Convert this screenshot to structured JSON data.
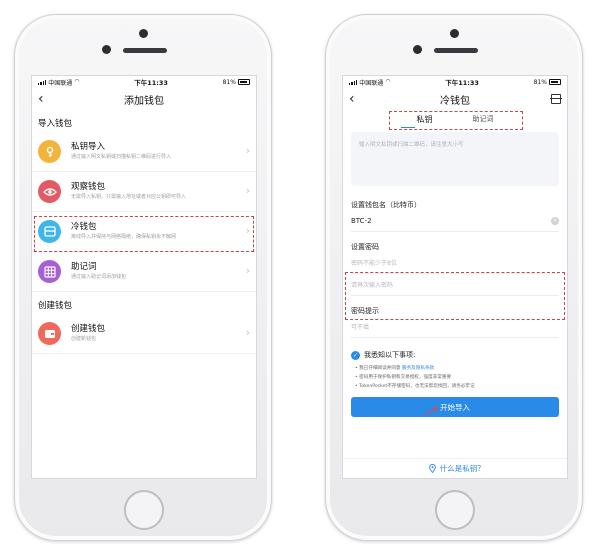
{
  "status_bar": {
    "carrier": "中国联通",
    "time": "下午11:33",
    "battery": "81%"
  },
  "left_screen": {
    "title": "添加钱包",
    "import_section": "导入钱包",
    "create_section": "创建钱包",
    "import_items": [
      {
        "title": "私钥导入",
        "desc": "通过输入明文私钥或扫描私钥二维码进行导入",
        "icon": "key-icon",
        "color": "#f2b43a"
      },
      {
        "title": "观察钱包",
        "desc": "无需导入私钥，只需输入地址或者对应公钥即可导入",
        "icon": "eye-icon",
        "color": "#e25a63"
      },
      {
        "title": "冷钱包",
        "desc": "离线导入并保持与网络隔绝，确保私钥永不触网",
        "icon": "cold-wallet-icon",
        "color": "#3fb6e8"
      },
      {
        "title": "助记词",
        "desc": "通过输入助记词添加钱包",
        "icon": "grid-icon",
        "color": "#a65fd6"
      }
    ],
    "create_items": [
      {
        "title": "创建钱包",
        "desc": "创建新钱包",
        "icon": "wallet-icon",
        "color": "#ef6a5a"
      }
    ]
  },
  "right_screen": {
    "title": "冷钱包",
    "tabs": [
      "私钥",
      "助记词"
    ],
    "key_placeholder": "输入明文私钥或扫描二维码，请注意大小写",
    "wallet_name_label": "设置钱包名（比特币）",
    "wallet_name_value": "BTC-2",
    "password_label": "设置密码",
    "password_placeholder": "密码不能少于8位",
    "password_confirm_placeholder": "请再次输入密码",
    "hint_label": "密码提示",
    "hint_placeholder": "可不填",
    "agree_title": "我悉知以下事项:",
    "notes": [
      {
        "text": "• 我已仔细阅读并同意 ",
        "link": "服务及隐私条款"
      },
      {
        "text": "• 密码用于保护私钥和交易授权，强度非常重要",
        "link": ""
      },
      {
        "text": "• TokenPocket不存储密码，也无法帮您找回，请务必牢记",
        "link": ""
      }
    ],
    "submit_label": "开始导入",
    "help_label": "什么是私钥?"
  },
  "colors": {
    "accent": "#2a8ae8",
    "annotation": "#c0474b"
  }
}
